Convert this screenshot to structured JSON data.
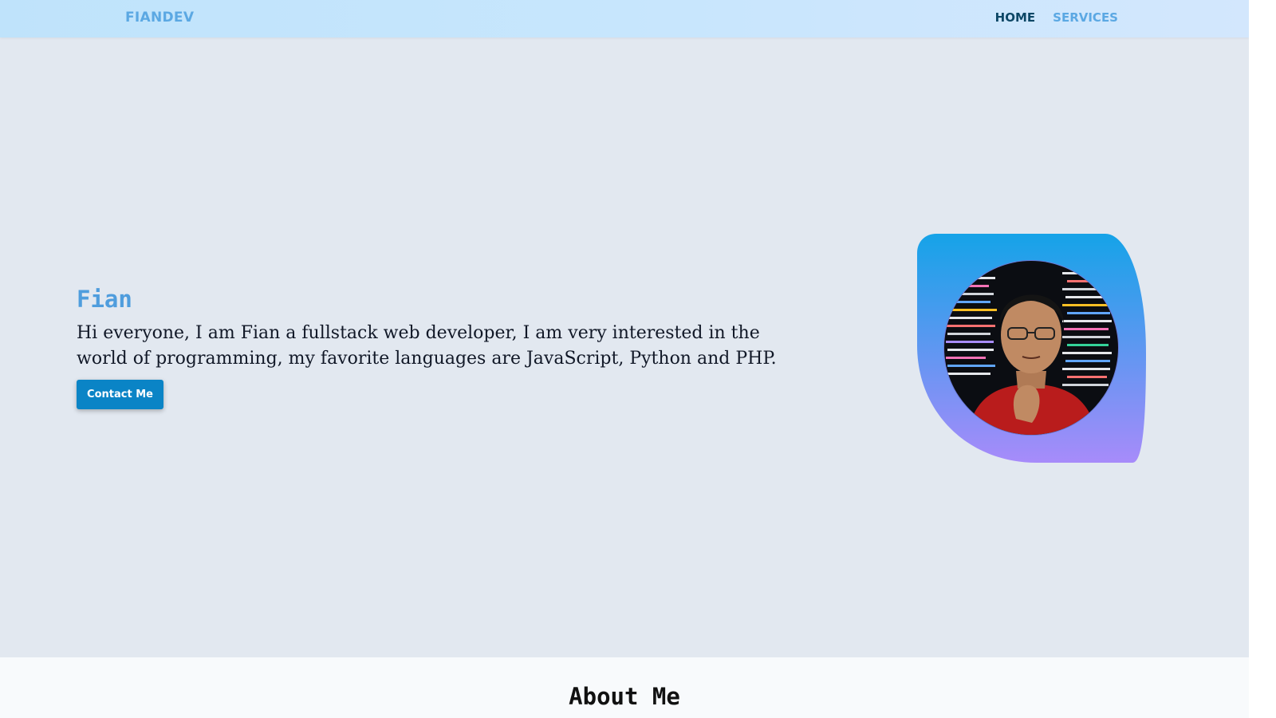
{
  "nav": {
    "brand": "FIANDEV",
    "links": [
      {
        "label": "HOME",
        "active": true
      },
      {
        "label": "SERVICES",
        "active": false
      }
    ]
  },
  "hero": {
    "name": "Fian",
    "description": "Hi everyone, I am Fian a fullstack web developer, I am very interested in the world of programming, my favorite languages are JavaScript, Python and PHP.",
    "cta_label": "Contact Me",
    "avatar_icon": "profile-photo-icon"
  },
  "about": {
    "title": "About Me"
  },
  "colors": {
    "brand": "#5ba8e3",
    "nav_active": "#0d4766",
    "hero_bg": "#e2e8f0",
    "button": "#0a84c6",
    "blob_top": "#15a3e8",
    "blob_bottom": "#a78bfa"
  }
}
